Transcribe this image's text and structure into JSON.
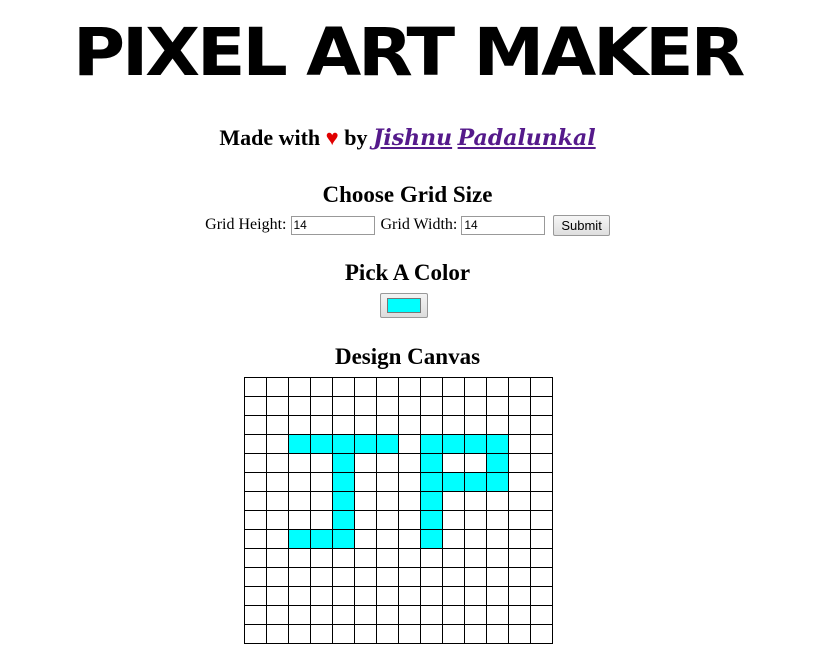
{
  "header": {
    "logo_text": "PIXEL ART MAKER",
    "made_with": "Made with",
    "heart": "♥",
    "by": "by",
    "author_first": "Jishnu",
    "author_last": "Padalunkal"
  },
  "grid_size": {
    "heading": "Choose Grid Size",
    "height_label": "Grid Height:",
    "height_value": "14",
    "width_label": "Grid Width:",
    "width_value": "14",
    "submit_label": "Submit"
  },
  "color_section": {
    "heading": "Pick A Color",
    "selected_color": "#00ffff"
  },
  "canvas_section": {
    "heading": "Design Canvas",
    "rows": 14,
    "cols": 14,
    "fill_color": "#00ffff",
    "filled_cells": [
      [
        3,
        2
      ],
      [
        3,
        3
      ],
      [
        3,
        4
      ],
      [
        3,
        5
      ],
      [
        3,
        6
      ],
      [
        3,
        8
      ],
      [
        3,
        9
      ],
      [
        3,
        10
      ],
      [
        3,
        11
      ],
      [
        4,
        4
      ],
      [
        4,
        8
      ],
      [
        4,
        11
      ],
      [
        5,
        4
      ],
      [
        5,
        8
      ],
      [
        5,
        9
      ],
      [
        5,
        10
      ],
      [
        5,
        11
      ],
      [
        6,
        4
      ],
      [
        6,
        8
      ],
      [
        7,
        4
      ],
      [
        7,
        8
      ],
      [
        8,
        2
      ],
      [
        8,
        3
      ],
      [
        8,
        4
      ],
      [
        8,
        8
      ]
    ]
  }
}
